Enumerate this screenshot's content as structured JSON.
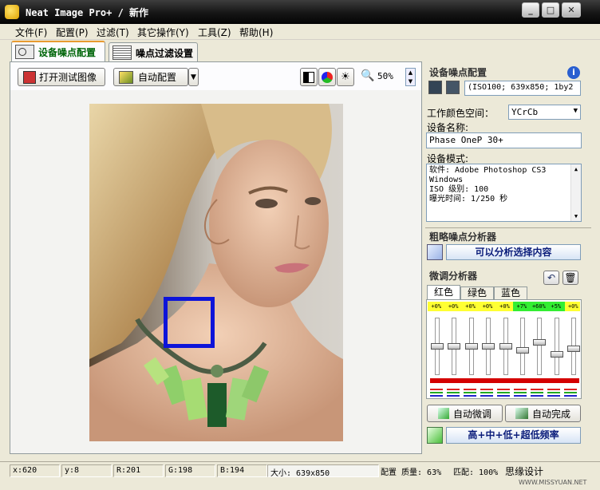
{
  "window": {
    "title": "Neat Image Pro+ / 新作",
    "min_label": "_",
    "max_label": "□",
    "close_label": "✕"
  },
  "menu": [
    {
      "label": "文件(F)"
    },
    {
      "label": "配置(P)"
    },
    {
      "label": "过滤(T)"
    },
    {
      "label": "其它操作(Y)"
    },
    {
      "label": "工具(Z)"
    },
    {
      "label": "帮助(H)"
    }
  ],
  "tabs": [
    {
      "label": "设备噪点配置",
      "active": true
    },
    {
      "label": "噪点过滤设置",
      "active": false
    }
  ],
  "toolbar": {
    "open_test_label": "打开测试图像",
    "auto_config_label": "自动配置",
    "zoom_value": "50%"
  },
  "right_panel": {
    "profile_title": "设备噪点配置",
    "profile_value": "(ISO100; 639x850; 1by2",
    "color_space_label": "工作颜色空间：",
    "color_space_value": "YCrCb",
    "device_name_label": "设备名称:",
    "device_name_value": "Phase OneP 30+",
    "device_mode_label": "设备模式:",
    "device_mode_lines": [
      "软件: Adobe Photoshop CS3",
      "Windows",
      "ISO 级别: 100",
      "曝光时间: 1/250 秒"
    ],
    "rough_analyzer_title": "粗略噪点分析器",
    "rough_analyzer_status": "可以分析选择内容",
    "fine_analyzer_title": "微调分析器",
    "channel_tabs": [
      "红色",
      "绿色",
      "蓝色"
    ],
    "active_channel": "红色",
    "band_labels": [
      "+0%",
      "+0%",
      "+0%",
      "+0%",
      "+0%",
      "+7%",
      "+60%",
      "+5%",
      "+0%"
    ],
    "band_levels": [
      0.5,
      0.5,
      0.5,
      0.5,
      0.5,
      0.42,
      0.58,
      0.35,
      0.45
    ],
    "auto_fine_label": "自动微调",
    "auto_finish_label": "自动完成",
    "frequency_label": "高+中+低+超低频率"
  },
  "status": {
    "x": "x:620",
    "y": "y:8",
    "r": "R:201",
    "g": "G:198",
    "b": "B:194",
    "size": "大小: 639x850",
    "config_quality": "配置 质量: 63%",
    "match": "匹配: 100%",
    "design": "思缘设计",
    "watermark": "WWW.MISSYUAN.NET"
  },
  "colors": {
    "selection_box": "#0d14d9",
    "active_tab_text": "#00660a",
    "red_bar": "#d40000",
    "band_yellow": "#ffff33",
    "band_green": "#33ee33"
  }
}
